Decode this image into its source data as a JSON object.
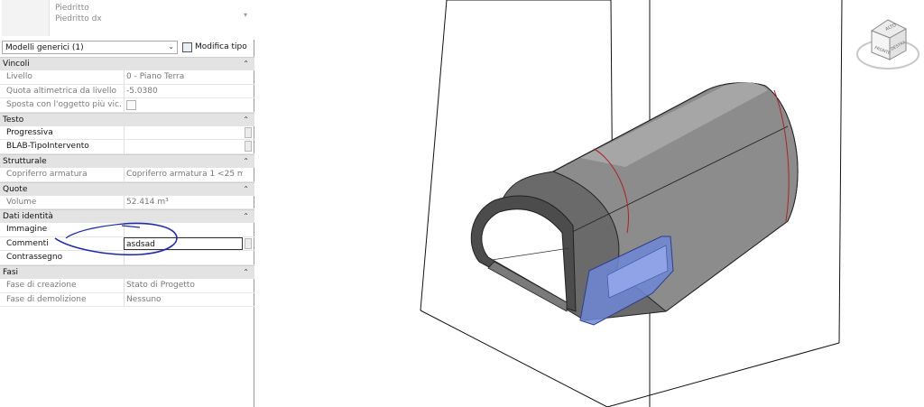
{
  "type_selector": {
    "family": "Piedritto",
    "type": "Piedritto dx",
    "category_filter": "Modelli generici (1)",
    "edit_type_label": "Modifica tipo"
  },
  "sections": [
    {
      "title": "Vincoli",
      "rows": [
        {
          "label": "Livello",
          "value": "0 - Piano Terra"
        },
        {
          "label": "Quota altimetrica da livello",
          "value": "-5.0380"
        },
        {
          "label": "Sposta con l'oggetto più vic...",
          "value": ""
        }
      ]
    },
    {
      "title": "Testo",
      "rows": [
        {
          "label": "Progressiva",
          "value": ""
        },
        {
          "label": "BLAB-TipoIntervento",
          "value": ""
        }
      ]
    },
    {
      "title": "Strutturale",
      "rows": [
        {
          "label": "Copriferro armatura",
          "value": "Copriferro armatura 1 <25 m..."
        }
      ]
    },
    {
      "title": "Quote",
      "rows": [
        {
          "label": "Volume",
          "value": "52.414 m³"
        }
      ]
    },
    {
      "title": "Dati identità",
      "rows": [
        {
          "label": "Immagine",
          "value": ""
        },
        {
          "label": "Commenti",
          "value": "asdsad"
        },
        {
          "label": "Contrassegno",
          "value": ""
        }
      ]
    },
    {
      "title": "Fasi",
      "rows": [
        {
          "label": "Fase di creazione",
          "value": "Stato di Progetto"
        },
        {
          "label": "Fase di demolizione",
          "value": "Nessuno"
        }
      ]
    }
  ],
  "viewcube": {
    "top_label": "ALTO",
    "front_label": "FRONTE",
    "right_label": "DESTRA"
  },
  "colors": {
    "selection_blue": "#6f86d6",
    "annotation_ink": "#1f2aa8",
    "section_header_bg": "#e3e3e3"
  },
  "icons": {
    "collapse_icon": "double-chevron-up",
    "dropdown_icon": "chevron-down",
    "edit_type_icon": "edit-type-icon",
    "viewcube_icon": "viewcube"
  }
}
